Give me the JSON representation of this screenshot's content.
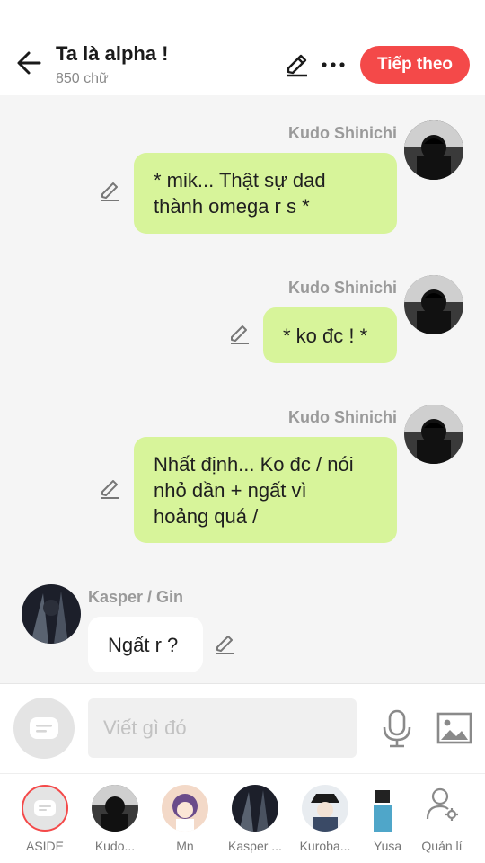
{
  "header": {
    "title": "Ta là alpha !",
    "word_count": "850 chữ",
    "next_label": "Tiếp theo",
    "back_icon": "arrow-left-icon",
    "edit_icon": "pencil-icon",
    "more_icon": "more-dots-icon",
    "accent_color": "#f44949"
  },
  "messages": [
    {
      "sender": "Kudo Shinichi",
      "side": "right",
      "lines": [
        "* mik... Thật sự dad",
        "thành omega r s *"
      ]
    },
    {
      "sender": "Kudo Shinichi",
      "side": "right",
      "lines": [
        "* ko đc ! *"
      ]
    },
    {
      "sender": "Kudo Shinichi",
      "side": "right",
      "lines": [
        "Nhất định... Ko đc / nói",
        "nhỏ dần + ngất vì",
        "hoảng quá /"
      ]
    },
    {
      "sender": "Kasper / Gin",
      "side": "left",
      "lines": [
        "Ngất r ?"
      ]
    }
  ],
  "bubble_colors": {
    "right": "#d7f49a",
    "left": "#ffffff"
  },
  "composer": {
    "placeholder": "Viết gì đó",
    "mic_icon": "microphone-icon",
    "image_icon": "image-icon",
    "aside_icon": "speech-bubble-icon"
  },
  "characters": [
    {
      "label": "ASIDE"
    },
    {
      "label": "Kudo..."
    },
    {
      "label": "Mn"
    },
    {
      "label": "Kasper ..."
    },
    {
      "label": "Kuroba..."
    },
    {
      "label": "Yusa"
    },
    {
      "label": "Quản lí"
    }
  ]
}
